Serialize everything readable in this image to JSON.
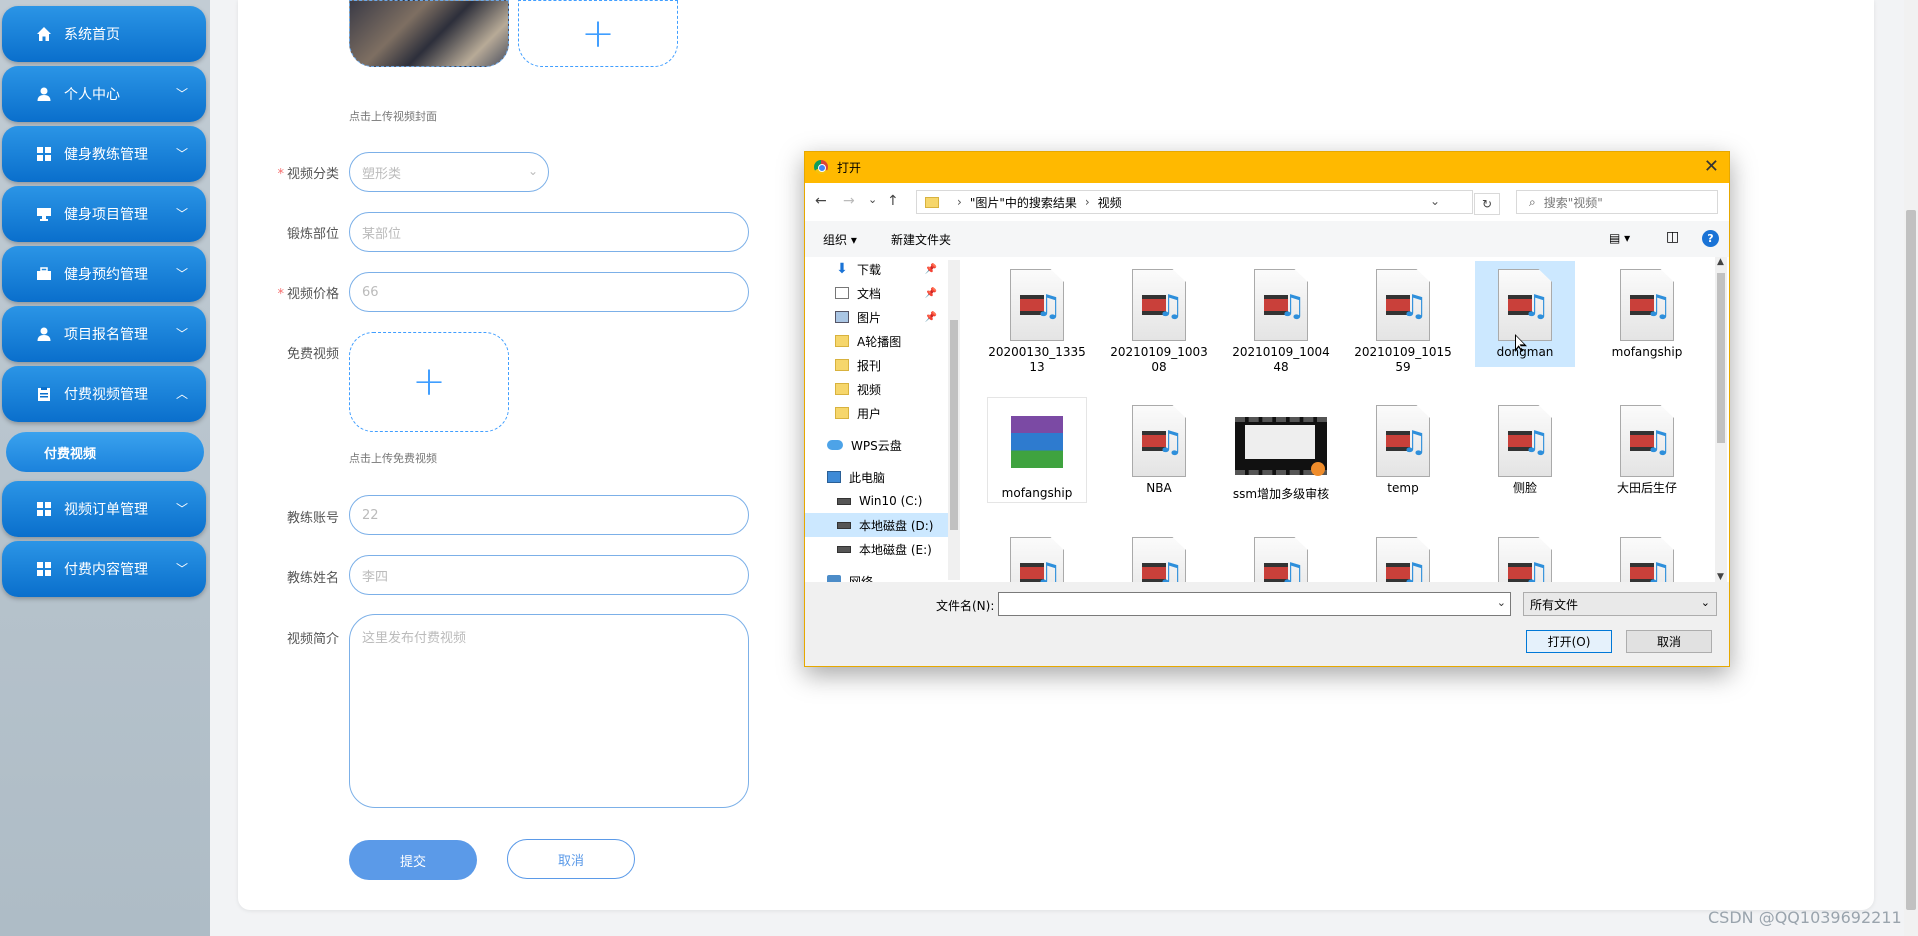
{
  "sidebar": {
    "items": [
      {
        "label": "系统首页",
        "icon": "home-icon",
        "chevron": ""
      },
      {
        "label": "个人中心",
        "icon": "user-icon",
        "chevron": "﹀"
      },
      {
        "label": "健身教练管理",
        "icon": "grid-icon",
        "chevron": "﹀"
      },
      {
        "label": "健身项目管理",
        "icon": "monitor-icon",
        "chevron": "﹀"
      },
      {
        "label": "健身预约管理",
        "icon": "briefcase-icon",
        "chevron": "﹀"
      },
      {
        "label": "项目报名管理",
        "icon": "user-icon",
        "chevron": "﹀"
      },
      {
        "label": "付费视频管理",
        "icon": "clipboard-icon",
        "chevron": "︿"
      },
      {
        "label": "视频订单管理",
        "icon": "grid-icon",
        "chevron": "﹀"
      },
      {
        "label": "付费内容管理",
        "icon": "grid-icon",
        "chevron": "﹀"
      }
    ],
    "sub_item": "付费视频"
  },
  "form": {
    "cover_hint": "点击上传视频封面",
    "category_label": "视频分类",
    "category_value": "塑形类",
    "body_part_label": "锻炼部位",
    "body_part_placeholder": "某部位",
    "price_label": "视频价格",
    "price_placeholder": "66",
    "free_video_label": "免费视频",
    "free_video_hint": "点击上传免费视频",
    "coach_account_label": "教练账号",
    "coach_account_placeholder": "22",
    "coach_name_label": "教练姓名",
    "coach_name_placeholder": "李四",
    "intro_label": "视频简介",
    "intro_placeholder": "这里发布付费视频",
    "submit_label": "提交",
    "cancel_label": "取消",
    "upload_plus": "+",
    "required_mark": "*"
  },
  "dialog": {
    "title": "打开",
    "close": "✕",
    "nav_back": "←",
    "nav_forward": "→",
    "nav_recent": "⌄",
    "nav_up": "↑",
    "breadcrumb": [
      "\"图片\"中的搜索结果",
      "视频"
    ],
    "crumb_sep": "›",
    "search_placeholder": "搜索\"视频\"",
    "toolbar": {
      "organize": "组织 ▾",
      "new_folder": "新建文件夹",
      "view": "▤ ▾",
      "pane": "◫",
      "help": "?"
    },
    "tree": [
      {
        "label": "下载",
        "icon": "download-icon",
        "pinned": true
      },
      {
        "label": "文档",
        "icon": "document-icon",
        "pinned": true
      },
      {
        "label": "图片",
        "icon": "picture-icon",
        "pinned": true
      },
      {
        "label": "A轮播图",
        "icon": "folder-icon",
        "pinned": false
      },
      {
        "label": "报刊",
        "icon": "folder-icon",
        "pinned": false
      },
      {
        "label": "视频",
        "icon": "folder-icon",
        "pinned": false
      },
      {
        "label": "用户",
        "icon": "folder-icon",
        "pinned": false
      },
      {
        "label": "WPS云盘",
        "icon": "cloud-icon",
        "pinned": false
      },
      {
        "label": "此电脑",
        "icon": "computer-icon",
        "pinned": false
      },
      {
        "label": "Win10 (C:)",
        "icon": "drive-icon",
        "pinned": false
      },
      {
        "label": "本地磁盘 (D:)",
        "icon": "drive-icon",
        "pinned": false,
        "selected": true
      },
      {
        "label": "本地磁盘 (E:)",
        "icon": "drive-icon",
        "pinned": false
      },
      {
        "label": "网络",
        "icon": "network-icon",
        "pinned": false
      }
    ],
    "files_row1": [
      {
        "name": "20200130_133513",
        "icon": "video-file-icon"
      },
      {
        "name": "20210109_100308",
        "icon": "video-file-icon"
      },
      {
        "name": "20210109_100448",
        "icon": "video-file-icon"
      },
      {
        "name": "20210109_101559",
        "icon": "video-file-icon"
      },
      {
        "name": "dongman",
        "icon": "video-file-icon",
        "selected": true
      },
      {
        "name": "mofangship",
        "icon": "video-file-icon"
      }
    ],
    "files_row2": [
      {
        "name": "mofangship",
        "icon": "archive-icon"
      },
      {
        "name": "NBA",
        "icon": "video-file-icon"
      },
      {
        "name": "ssm增加多级审核",
        "icon": "video-thumbnail-icon"
      },
      {
        "name": "temp",
        "icon": "video-file-icon"
      },
      {
        "name": "侧脸",
        "icon": "video-file-icon"
      },
      {
        "name": "大田后生仔",
        "icon": "video-file-icon"
      }
    ],
    "filename_label": "文件名(N):",
    "filetype": "所有文件",
    "open_button": "打开(O)",
    "cancel_button": "取消"
  },
  "watermark": "CSDN @QQ1039692211",
  "colors": {
    "sidebar_blue": "#0a6fcc",
    "form_border": "#7cb0e8",
    "submit_blue": "#5b9ae8",
    "dialog_title": "#ffb900"
  }
}
